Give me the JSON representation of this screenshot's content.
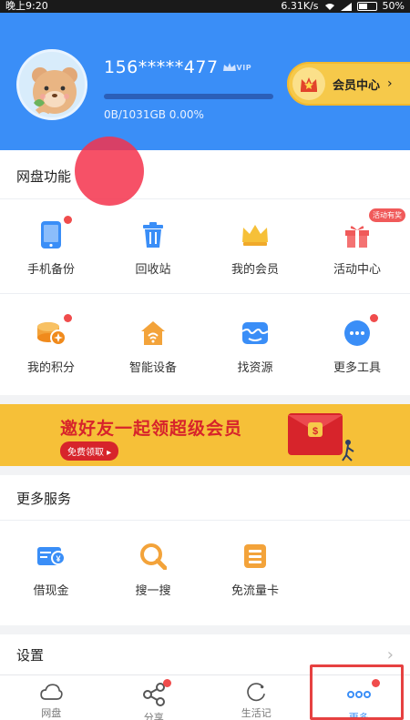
{
  "status_bar": {
    "time": "晚上9:20",
    "speed": "6.31K/s",
    "battery": "50%"
  },
  "profile": {
    "phone": "156*****477",
    "vip_badge": "VIP",
    "storage": "0B/1031GB 0.00%",
    "storage_used_fraction": 0.0,
    "vip_center_label": "会员中心",
    "vip_center_chevron": "›"
  },
  "netdisk": {
    "title": "网盘功能",
    "row1": [
      {
        "label": "手机备份",
        "icon": "phone-icon",
        "dot": true,
        "tag": ""
      },
      {
        "label": "回收站",
        "icon": "trash-icon",
        "dot": false,
        "tag": ""
      },
      {
        "label": "我的会员",
        "icon": "crown-icon",
        "dot": false,
        "tag": ""
      },
      {
        "label": "活动中心",
        "icon": "gift-icon",
        "dot": false,
        "tag": "活动有奖"
      }
    ],
    "row2": [
      {
        "label": "我的积分",
        "icon": "coins-icon",
        "dot": true,
        "tag": ""
      },
      {
        "label": "智能设备",
        "icon": "smart-home-icon",
        "dot": false,
        "tag": ""
      },
      {
        "label": "找资源",
        "icon": "find-resource-icon",
        "dot": false,
        "tag": ""
      },
      {
        "label": "更多工具",
        "icon": "more-tools-icon",
        "dot": true,
        "tag": ""
      }
    ]
  },
  "banner": {
    "title": "邀好友一起领超级会员",
    "button": "免费领取 ▸"
  },
  "more_services": {
    "title": "更多服务",
    "items": [
      {
        "label": "借现金",
        "icon": "cash-card-icon"
      },
      {
        "label": "搜一搜",
        "icon": "search-icon"
      },
      {
        "label": "免流量卡",
        "icon": "data-card-icon"
      }
    ]
  },
  "settings": {
    "label": "设置",
    "chevron": "›"
  },
  "bottom_nav": [
    {
      "label": "网盘",
      "icon": "cloud-icon",
      "dot": false,
      "active": false
    },
    {
      "label": "分享",
      "icon": "share-icon",
      "dot": true,
      "active": false
    },
    {
      "label": "生活记",
      "icon": "life-icon",
      "dot": false,
      "active": false
    },
    {
      "label": "更多",
      "icon": "more-dots-icon",
      "dot": true,
      "active": true
    }
  ],
  "colors": {
    "header_blue": "#3a8ef7",
    "accent_red": "#f04c4c",
    "banner_yellow": "#f6c038"
  }
}
